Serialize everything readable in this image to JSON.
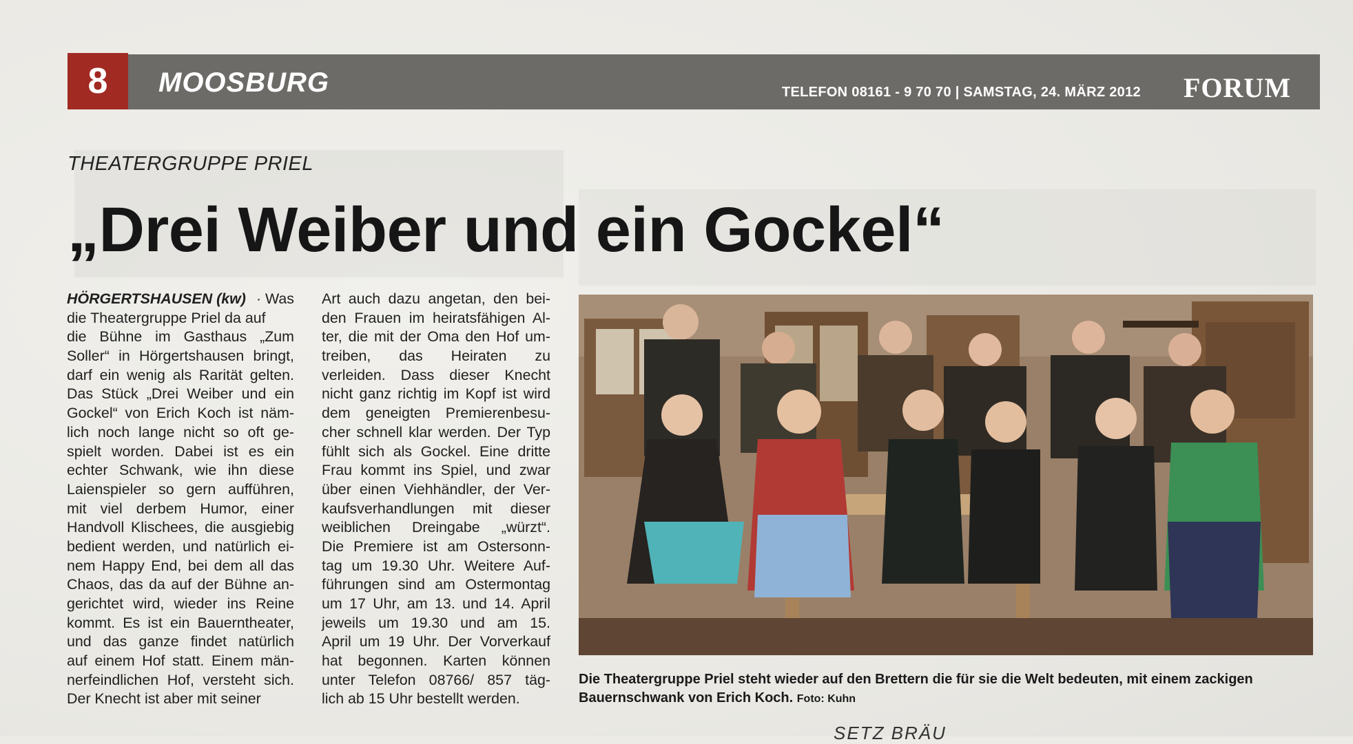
{
  "header": {
    "page_number": "8",
    "section": "MOOSBURG",
    "info": "TELEFON 08161 - 9 70 70 | SAMSTAG, 24. MÄRZ 2012",
    "logo": "FORUM"
  },
  "article": {
    "kicker": "THEATERGRUPPE PRIEL",
    "headline": "„Drei Weiber und ein Gockel“",
    "lead": "HÖRGERTSHAUSEN (kw)",
    "col1_lines": [
      " · Was",
      "die Theatergruppe Priel da auf",
      "die Bühne im Gasthaus „Zum",
      "Soller“ in Hörgertshausen bringt,",
      "darf ein wenig als Rarität gelten.",
      "Das Stück „Drei Weiber und ein",
      "Gockel“ von Erich Koch ist näm-",
      "lich noch lange nicht so oft ge-",
      "spielt worden. Dabei ist es ein",
      "echter Schwank, wie ihn diese",
      "Laienspieler so gern aufführen,",
      "mit viel derbem Humor, einer",
      "Handvoll Klischees, die ausgiebig",
      "bedient werden, und natürlich ei-",
      "nem Happy End, bei dem all das",
      "Chaos, das da auf der Bühne an-",
      "gerichtet wird, wieder ins Reine",
      "kommt. Es ist ein Bauerntheater,",
      "und das ganze findet natürlich",
      "auf einem Hof statt. Einem män-",
      "nerfeindlichen Hof, versteht sich.",
      "Der Knecht ist aber mit seiner"
    ],
    "col2_lines": [
      "Art auch dazu angetan, den bei-",
      "den Frauen im heiratsfähigen Al-",
      "ter, die mit der Oma den Hof um-",
      "treiben, das Heiraten zu",
      "verleiden. Dass dieser Knecht",
      "nicht ganz richtig im Kopf ist wird",
      "dem geneigten Premierenbesu-",
      "cher schnell klar werden. Der Typ",
      "fühlt sich als Gockel. Eine dritte",
      "Frau kommt ins Spiel, und zwar",
      "über einen Viehhändler, der Ver-",
      "kaufsverhandlungen mit dieser",
      "weiblichen Dreingabe „würzt“.",
      "Die Premiere ist am Ostersonn-",
      "tag um 19.30 Uhr. Weitere Auf-",
      "führungen sind am Ostermontag",
      "um 17 Uhr, am 13. und 14. April",
      "jeweils um 19.30 und am 15.",
      "April um 19 Uhr. Der Vorverkauf",
      "hat begonnen. Karten können",
      "unter Telefon 08766/ 857 täg-",
      "lich ab 15 Uhr bestellt werden."
    ],
    "caption": "Die Theatergruppe Priel steht wieder auf den Brettern die für sie die Welt bedeuten, mit einem zackigen Bauernschwank von Erich Koch.",
    "photo_credit": "Foto: Kuhn"
  },
  "footer": {
    "next_heading": "SETZ BRÄU"
  }
}
